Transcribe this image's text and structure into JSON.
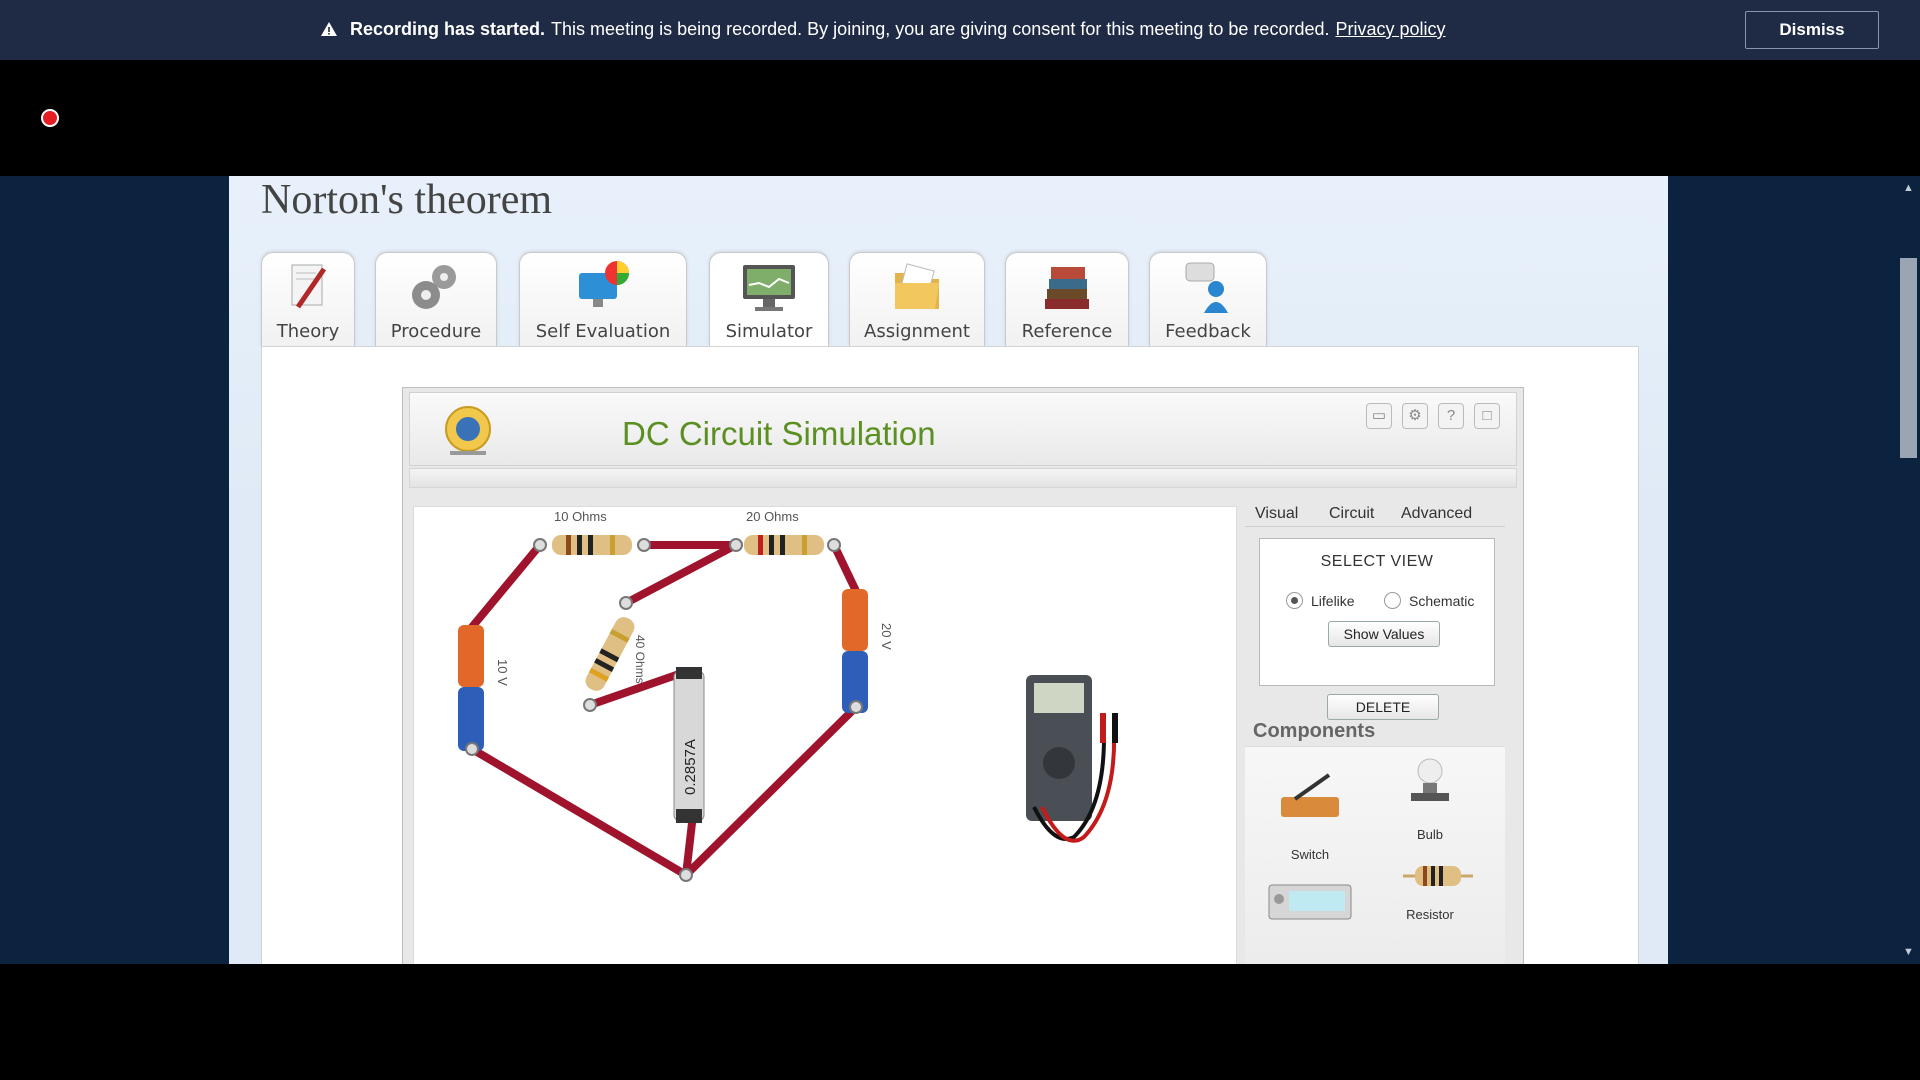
{
  "banner": {
    "strong": "Recording has started.",
    "message": "This meeting is being recorded. By joining, you are giving consent for this meeting to be recorded.",
    "link": "Privacy policy",
    "dismiss": "Dismiss"
  },
  "page": {
    "title": "Norton's theorem",
    "tabs": [
      {
        "label": "Theory",
        "icon": "theory-icon"
      },
      {
        "label": "Procedure",
        "icon": "gears-icon"
      },
      {
        "label": "Self Evaluation",
        "icon": "self-evaluation-icon"
      },
      {
        "label": "Simulator",
        "icon": "monitor-icon"
      },
      {
        "label": "Assignment",
        "icon": "folder-icon"
      },
      {
        "label": "Reference",
        "icon": "books-icon"
      },
      {
        "label": "Feedback",
        "icon": "feedback-icon"
      }
    ],
    "active_tab": "Simulator"
  },
  "simulator": {
    "title": "DC Circuit Simulation",
    "circuit_labels": {
      "r1": "10 Ohms",
      "r2": "20 Ohms",
      "r3": "40 Ohms",
      "v1": "10 V",
      "v2": "20 V",
      "ammeter": "0.2857A"
    },
    "panel": {
      "tabs": [
        "Visual",
        "Circuit",
        "Advanced"
      ],
      "select_view": "SELECT VIEW",
      "options": [
        "Lifelike",
        "Schematic"
      ],
      "selected_option": "Lifelike",
      "show_values": "Show Values",
      "delete": "DELETE",
      "components_title": "Components",
      "components": [
        "Switch",
        "Bulb",
        "Resistor"
      ]
    }
  }
}
